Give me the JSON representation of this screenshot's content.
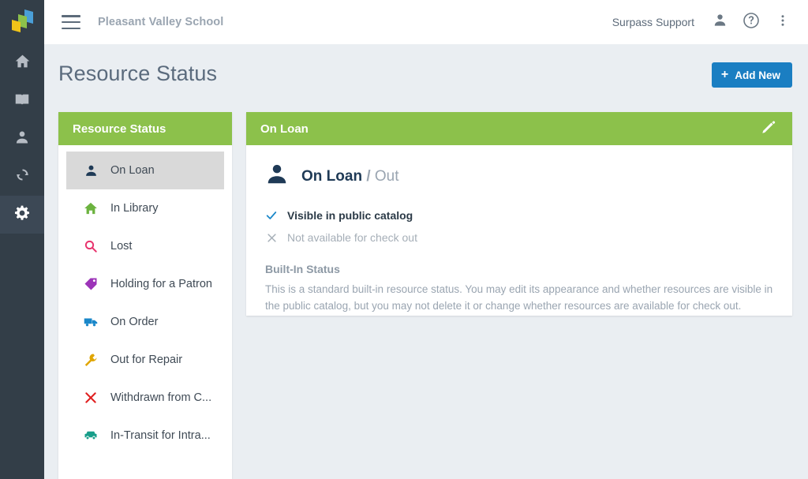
{
  "theme": {
    "green": "#8cc14b",
    "blue": "#1a7ec2",
    "rail_bg": "#333e48",
    "page_bg": "#eaeef2",
    "navy": "#1f3a56"
  },
  "rail": {
    "logo": "surpass-logo",
    "items": [
      {
        "icon": "home-icon",
        "name": "home",
        "active": false
      },
      {
        "icon": "book-icon",
        "name": "catalog",
        "active": false
      },
      {
        "icon": "person-icon",
        "name": "patrons",
        "active": false
      },
      {
        "icon": "sync-icon",
        "name": "circulation",
        "active": false
      },
      {
        "icon": "gear-icon",
        "name": "settings",
        "active": true
      }
    ]
  },
  "topbar": {
    "menu_icon": "hamburger-icon",
    "school_name": "Pleasant Valley School",
    "user_name": "Surpass Support",
    "user_icon": "person-icon",
    "help_icon": "help-circle-icon",
    "overflow_icon": "more-vertical-icon"
  },
  "page": {
    "title": "Resource Status",
    "add_button": {
      "label": "Add New",
      "plus": "+"
    }
  },
  "left_panel": {
    "header": "Resource Status",
    "items": [
      {
        "label": "On Loan",
        "icon": "person-icon",
        "color": "#1f3a56",
        "selected": true
      },
      {
        "label": "In Library",
        "icon": "home-icon",
        "color": "#6cb33f",
        "selected": false
      },
      {
        "label": "Lost",
        "icon": "search-icon",
        "color": "#e8336d",
        "selected": false
      },
      {
        "label": "Holding for a Patron",
        "icon": "tag-icon",
        "color": "#9c34b8",
        "selected": false
      },
      {
        "label": "On Order",
        "icon": "truck-icon",
        "color": "#1a87c9",
        "selected": false
      },
      {
        "label": "Out for Repair",
        "icon": "wrench-icon",
        "color": "#e0a500",
        "selected": false
      },
      {
        "label": "Withdrawn from C...",
        "icon": "x-icon",
        "color": "#e02020",
        "selected": false
      },
      {
        "label": "In-Transit for Intra...",
        "icon": "car-icon",
        "color": "#189e8a",
        "selected": false
      }
    ]
  },
  "detail": {
    "header": "On Loan",
    "edit_icon": "pencil-icon",
    "status_icon": "person-icon",
    "name": "On Loan",
    "separator": "/",
    "alt_name": "Out",
    "flags": [
      {
        "icon": "check-icon",
        "label": "Visible in public catalog",
        "state": "on"
      },
      {
        "icon": "x-icon",
        "label": "Not available for check out",
        "state": "off"
      }
    ],
    "builtin_label": "Built-In Status",
    "builtin_text": "This is a standard built-in resource status. You may edit its appearance and whether resources are visible in the public catalog, but you may not delete it or change whether resources are available for check out."
  }
}
